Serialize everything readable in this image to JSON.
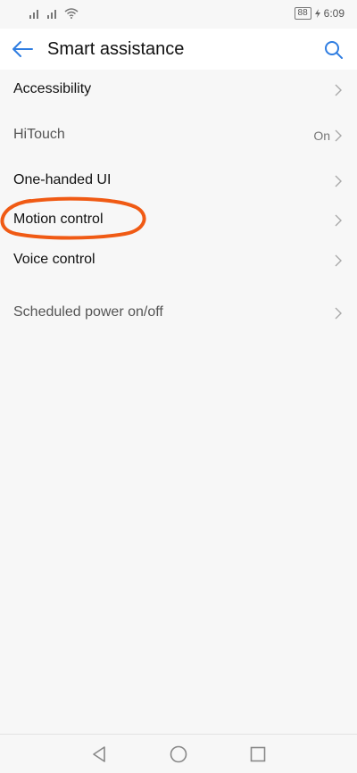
{
  "status_bar": {
    "battery": "88",
    "time": "6:09"
  },
  "header": {
    "title": "Smart assistance"
  },
  "items": [
    {
      "label": "Accessibility",
      "value": ""
    },
    {
      "label": "HiTouch",
      "value": "On"
    },
    {
      "label": "One-handed UI",
      "value": ""
    },
    {
      "label": "Motion control",
      "value": ""
    },
    {
      "label": "Voice control",
      "value": ""
    },
    {
      "label": "Scheduled power on/off",
      "value": ""
    }
  ],
  "colors": {
    "accent": "#2f7de1",
    "annotation": "#f05a14"
  },
  "icons": {
    "back": "back-arrow-icon",
    "search": "search-icon",
    "nav_back": "triangle-back-icon",
    "nav_home": "circle-home-icon",
    "nav_recent": "square-recent-icon"
  }
}
